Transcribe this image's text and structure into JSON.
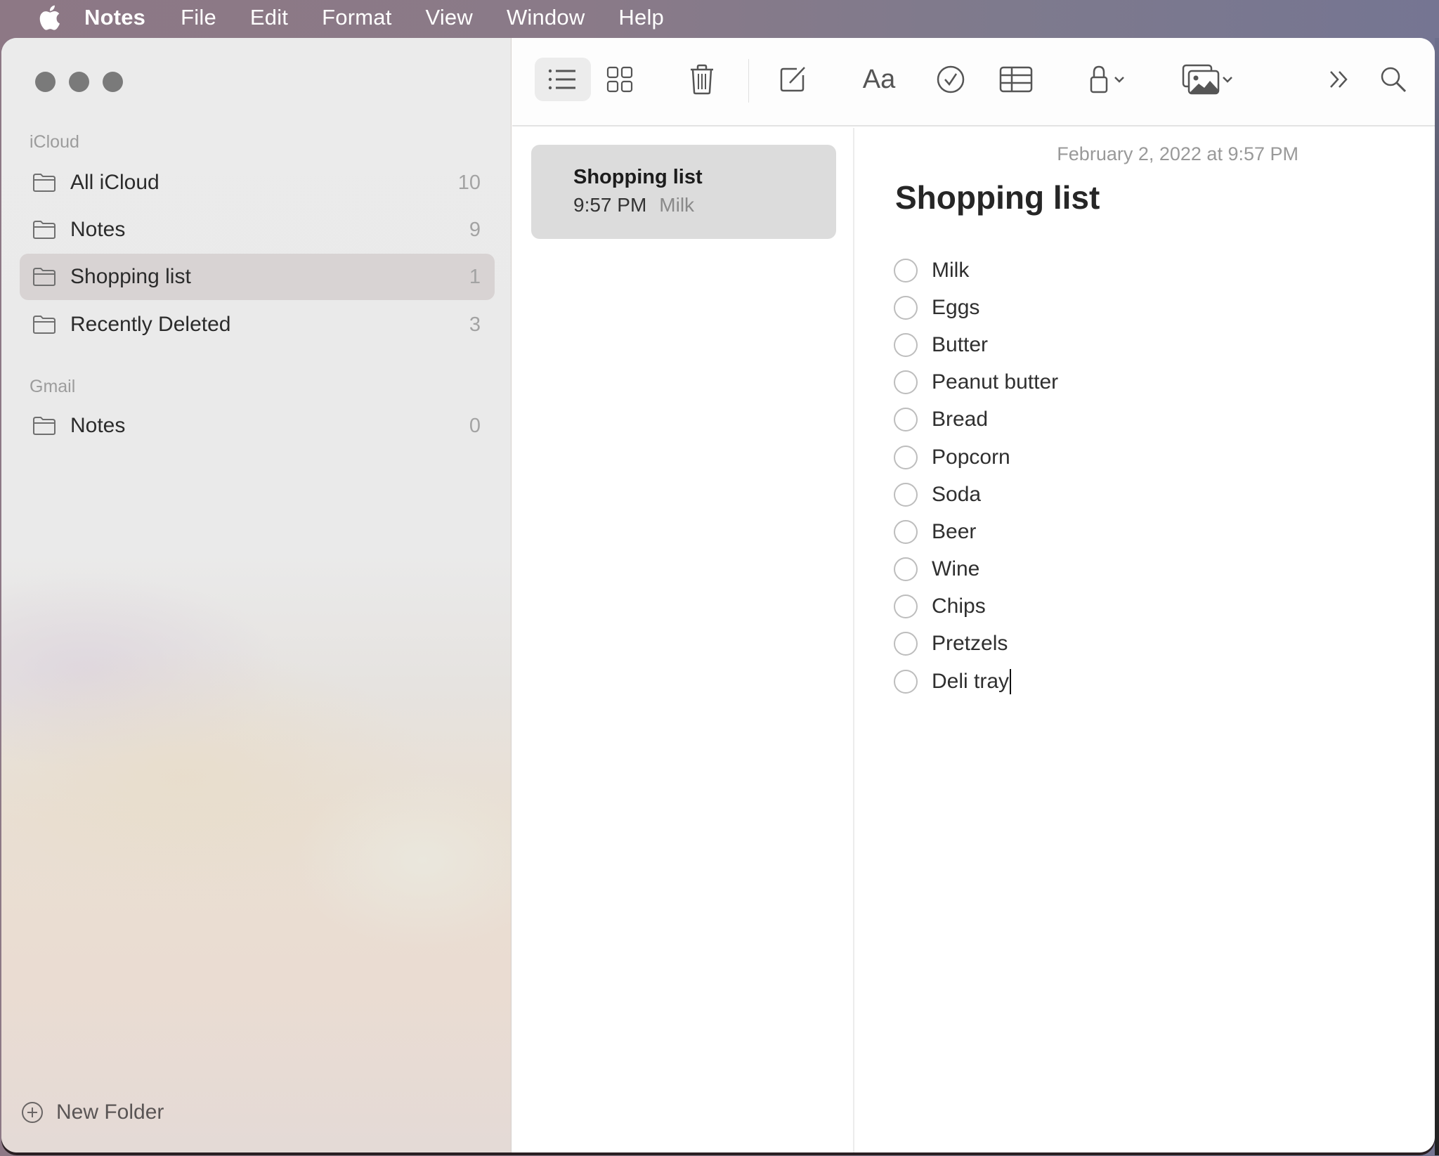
{
  "menubar": {
    "apple_icon": "apple-logo-icon",
    "app_name": "Notes",
    "items": [
      "File",
      "Edit",
      "Format",
      "View",
      "Window",
      "Help"
    ]
  },
  "sidebar": {
    "sections": [
      {
        "label": "iCloud",
        "folders": [
          {
            "label": "All iCloud",
            "count": "10",
            "selected": false
          },
          {
            "label": "Notes",
            "count": "9",
            "selected": false
          },
          {
            "label": "Shopping list",
            "count": "1",
            "selected": true
          },
          {
            "label": "Recently Deleted",
            "count": "3",
            "selected": false
          }
        ]
      },
      {
        "label": "Gmail",
        "folders": [
          {
            "label": "Notes",
            "count": "0",
            "selected": false
          }
        ]
      }
    ],
    "new_folder_label": "New Folder"
  },
  "toolbar": {
    "buttons": [
      {
        "name": "list-view",
        "icon": "list-icon",
        "active": true
      },
      {
        "name": "gallery-view",
        "icon": "grid-icon",
        "active": false
      },
      {
        "name": "delete",
        "icon": "trash-icon",
        "active": false
      },
      {
        "name": "compose",
        "icon": "compose-icon",
        "active": false
      },
      {
        "name": "format",
        "icon": "text-format-icon",
        "label": "Aa",
        "active": false
      },
      {
        "name": "checklist",
        "icon": "checkmark-circle-icon",
        "active": false
      },
      {
        "name": "table",
        "icon": "table-icon",
        "active": false
      },
      {
        "name": "lock",
        "icon": "lock-icon",
        "active": false
      },
      {
        "name": "media",
        "icon": "photo-icon",
        "active": false
      },
      {
        "name": "more",
        "icon": "chevron-double-right-icon",
        "active": false
      },
      {
        "name": "search",
        "icon": "search-icon",
        "active": false
      }
    ]
  },
  "note_list": {
    "notes": [
      {
        "title": "Shopping list",
        "time": "9:57 PM",
        "preview": "Milk",
        "selected": true
      }
    ]
  },
  "editor": {
    "date": "February 2, 2022 at 9:57 PM",
    "title": "Shopping list",
    "checklist": [
      {
        "text": "Milk",
        "checked": false
      },
      {
        "text": "Eggs",
        "checked": false
      },
      {
        "text": "Butter",
        "checked": false
      },
      {
        "text": "Peanut butter",
        "checked": false
      },
      {
        "text": "Bread",
        "checked": false
      },
      {
        "text": "Popcorn",
        "checked": false
      },
      {
        "text": "Soda",
        "checked": false
      },
      {
        "text": "Beer",
        "checked": false
      },
      {
        "text": "Wine",
        "checked": false
      },
      {
        "text": "Chips",
        "checked": false
      },
      {
        "text": "Pretzels",
        "checked": false
      },
      {
        "text": "Deli tray",
        "checked": false
      }
    ]
  },
  "colors": {
    "icon_gray": "#555555",
    "selected_row": "#d8d3d3",
    "note_card": "#dcdcdc",
    "checkbox_border": "#bdbdbd"
  }
}
